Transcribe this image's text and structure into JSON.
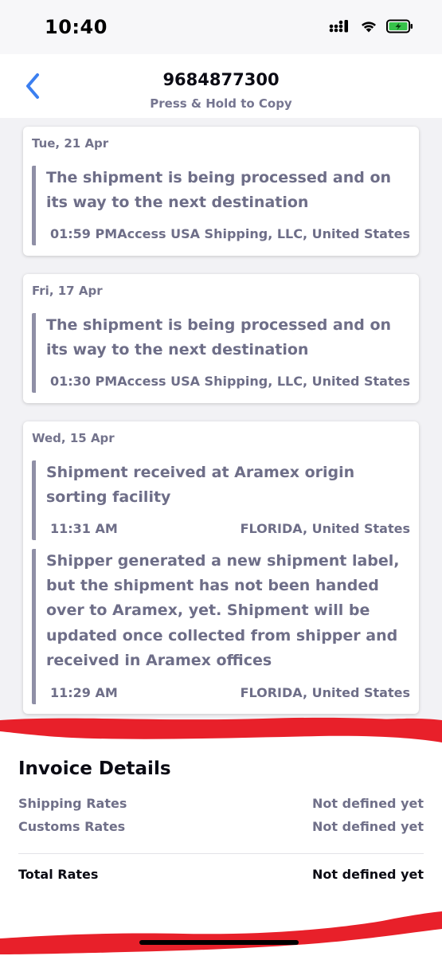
{
  "status_bar": {
    "time": "10:40",
    "icons": [
      "cellular-signal-icon",
      "wifi-icon",
      "battery-charging-icon"
    ],
    "battery_color": "#37c24a"
  },
  "header": {
    "back_icon": "chevron-left-icon",
    "tracking_number": "9684877300",
    "subtitle": "Press & Hold to Copy",
    "accent_color": "#3b7ff0"
  },
  "cards": [
    {
      "date": "Tue, 21 Apr",
      "events": [
        {
          "description": "The shipment is being processed and on its way to the next destination",
          "time": "01:59 PM",
          "location": "Access USA Shipping, LLC, United States"
        }
      ]
    },
    {
      "date": "Fri, 17 Apr",
      "events": [
        {
          "description": "The shipment is being processed and on its way to the next destination",
          "time": "01:30 PM",
          "location": "Access USA Shipping, LLC, United States"
        }
      ]
    },
    {
      "date": "Wed, 15 Apr",
      "events": [
        {
          "description": "Shipment received at Aramex origin sorting facility",
          "time": "11:31 AM",
          "location": "FLORIDA, United States"
        },
        {
          "description": "Shipper generated a new shipment label, but the shipment has not been handed over to Aramex, yet. Shipment will be updated once collected from shipper and received in Aramex offices",
          "time": "11:29 AM",
          "location": "FLORIDA, United States"
        }
      ]
    }
  ],
  "invoice": {
    "title": "Invoice Details",
    "rows": [
      {
        "label": "Shipping Rates",
        "value": "Not defined yet"
      },
      {
        "label": "Customs Rates",
        "value": "Not defined yet"
      }
    ],
    "total_label": "Total Rates",
    "total_value": "Not defined yet"
  },
  "annotation_color": "#e8202a"
}
